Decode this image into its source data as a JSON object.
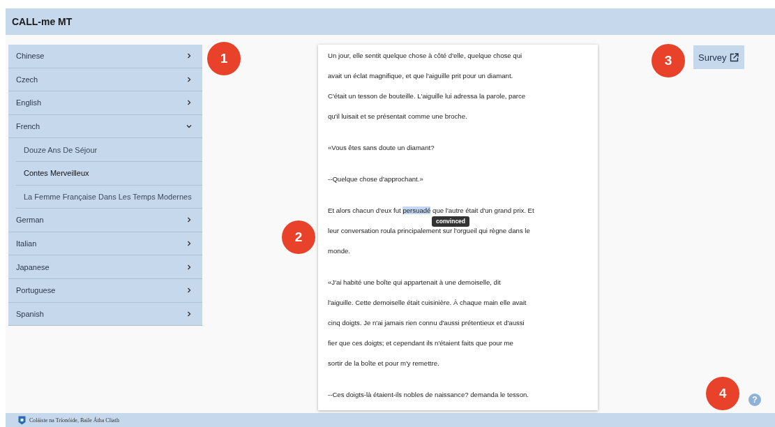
{
  "app_bar": {
    "title": "CALL-me MT"
  },
  "sidebar": {
    "items": [
      {
        "label": "Chinese",
        "expanded": false
      },
      {
        "label": "Czech",
        "expanded": false
      },
      {
        "label": "English",
        "expanded": false
      },
      {
        "label": "French",
        "expanded": true,
        "children": [
          {
            "label": "Douze Ans De Séjour",
            "selected": false
          },
          {
            "label": "Contes Merveilleux",
            "selected": true
          },
          {
            "label": "La Femme Française Dans Les Temps Modernes",
            "selected": false
          }
        ]
      },
      {
        "label": "German",
        "expanded": false
      },
      {
        "label": "Italian",
        "expanded": false
      },
      {
        "label": "Japanese",
        "expanded": false
      },
      {
        "label": "Portuguese",
        "expanded": false
      },
      {
        "label": "Spanish",
        "expanded": false
      }
    ]
  },
  "reader": {
    "paragraphs": [
      {
        "lines": [
          {
            "kind": "plain",
            "text": "Un jour, elle sentit quelque chose à côté d'elle, quelque chose qui"
          },
          {
            "kind": "plain",
            "text": "avait un éclat magnifique, et que l'aiguille prit pour un diamant."
          },
          {
            "kind": "plain",
            "text": "C'était un tesson de bouteille. L'aiguille lui adressa la parole, parce"
          },
          {
            "kind": "plain",
            "text": "qu'il luisait et se présentait comme une broche."
          }
        ]
      },
      {
        "lines": [
          {
            "kind": "plain",
            "text": "«Vous êtes sans doute un diamant?"
          }
        ]
      },
      {
        "lines": [
          {
            "kind": "plain",
            "text": "--Quelque chose d'approchant.»"
          }
        ]
      },
      {
        "lines": [
          {
            "kind": "highlight",
            "before": "Et alors chacun d'eux fut ",
            "word": "persuadé",
            "after": " que l'autre était d'un grand prix. Et",
            "tooltip": "convinced"
          },
          {
            "kind": "plain",
            "text": "leur conversation roula principalement sur l'orgueil qui règne dans le"
          },
          {
            "kind": "plain",
            "text": "monde."
          }
        ]
      },
      {
        "lines": [
          {
            "kind": "plain",
            "text": "«J'ai habité une boîte qui appartenait à une demoiselle, dit"
          },
          {
            "kind": "plain",
            "text": "l'aiguille. Cette demoiselle était cuisinière. À chaque main elle avait"
          },
          {
            "kind": "plain",
            "text": "cinq doigts. Je n'ai jamais rien connu d'aussi prétentieux et d'aussi"
          },
          {
            "kind": "plain",
            "text": "fier que ces doigts; et cependant ils n'étaient faits que pour me"
          },
          {
            "kind": "plain",
            "text": "sortir de la boîte et pour m'y remettre."
          }
        ]
      },
      {
        "lines": [
          {
            "kind": "plain",
            "text": "--Ces doigts-là étaient-ils nobles de naissance? demanda le tesson."
          }
        ]
      }
    ]
  },
  "survey_button": {
    "label": "Survey"
  },
  "help": {
    "icon": "?"
  },
  "annotations": [
    {
      "label": "1"
    },
    {
      "label": "2"
    },
    {
      "label": "3"
    },
    {
      "label": "4"
    }
  ],
  "footer": {
    "institution": "Coláiste na Tríonóide, Baile Átha Cliath"
  }
}
